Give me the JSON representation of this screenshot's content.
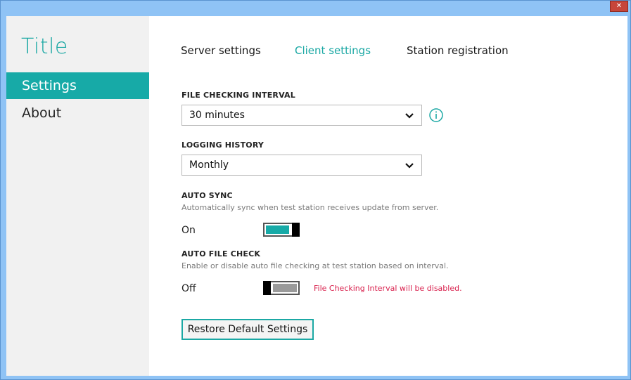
{
  "window": {
    "close_glyph": "✕"
  },
  "sidebar": {
    "title": "Title",
    "items": [
      {
        "label": "Settings",
        "active": true
      },
      {
        "label": "About",
        "active": false
      }
    ]
  },
  "tabs": [
    {
      "label": "Server settings",
      "active": false
    },
    {
      "label": "Client settings",
      "active": true
    },
    {
      "label": "Station registration",
      "active": false
    }
  ],
  "settings": {
    "file_checking_interval": {
      "label": "FILE CHECKING INTERVAL",
      "value": "30 minutes",
      "info_icon": "info-icon"
    },
    "logging_history": {
      "label": "LOGGING HISTORY",
      "value": "Monthly"
    },
    "auto_sync": {
      "label": "AUTO SYNC",
      "description": "Automatically sync when test station receives update from server.",
      "state_text": "On",
      "enabled": true
    },
    "auto_file_check": {
      "label": "AUTO FILE CHECK",
      "description": "Enable or disable auto file checking at test station based on interval.",
      "state_text": "Off",
      "enabled": false,
      "warning": "File Checking Interval will be disabled."
    },
    "restore_button": "Restore Default Settings"
  },
  "colors": {
    "accent": "#17aaa7",
    "warning": "#d81e4b",
    "window_frame": "#8fc3f5"
  }
}
